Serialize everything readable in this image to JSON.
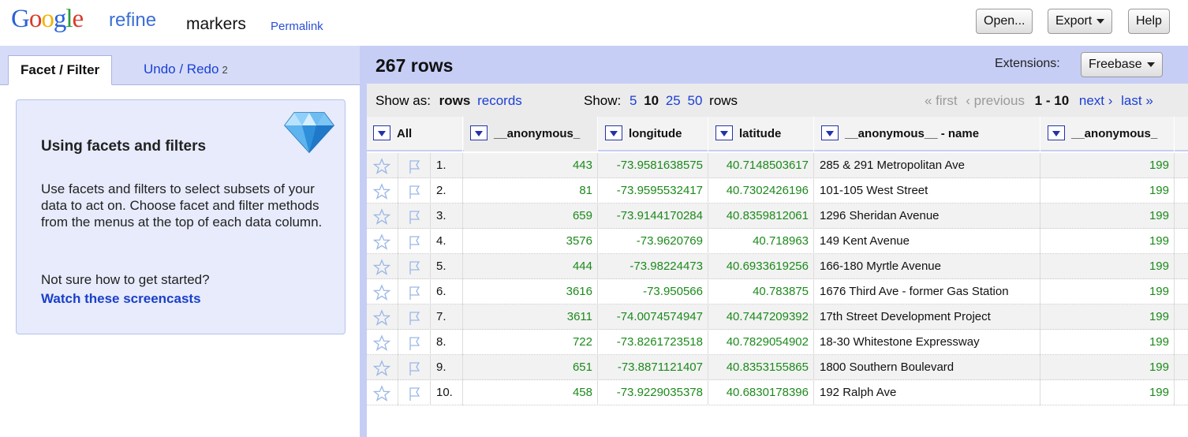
{
  "header": {
    "logo_word": "Google",
    "logo_product": "refine",
    "project_name": "markers",
    "permalink": "Permalink",
    "buttons": {
      "open": "Open...",
      "export": "Export",
      "help": "Help"
    }
  },
  "left_panel": {
    "tabs": {
      "facet": "Facet / Filter",
      "undo": "Undo / Redo",
      "undo_count": "2"
    },
    "help": {
      "title": "Using facets and filters",
      "body": "Use facets and filters to select subsets of your data to act on. Choose facet and filter methods from the menus at the top of each data column.",
      "question": "Not sure how to get started?",
      "link": "Watch these screencasts"
    }
  },
  "summary": {
    "row_count": "267 rows",
    "extensions_label": "Extensions:",
    "extensions_value": "Freebase"
  },
  "view_bar": {
    "show_as_label": "Show as:",
    "show_as_rows": "rows",
    "show_as_records": "records",
    "show_label": "Show:",
    "page_sizes": [
      "5",
      "10",
      "25",
      "50"
    ],
    "page_size_selected": "10",
    "rows_word": "rows",
    "first": "« first",
    "previous": "‹ previous",
    "range": "1 - 10",
    "next": "next ›",
    "last": "last »"
  },
  "table": {
    "all_label": "All",
    "columns": [
      "__anonymous_",
      "longitude",
      "latitude",
      "__anonymous__ - name",
      "__anonymous_"
    ],
    "rows": [
      {
        "index": "1.",
        "anon": "443",
        "longitude": "-73.9581638575",
        "latitude": "40.7148503617",
        "name": "285 & 291 Metropolitan Ave",
        "anon2": "199"
      },
      {
        "index": "2.",
        "anon": "81",
        "longitude": "-73.9595532417",
        "latitude": "40.7302426196",
        "name": "101-105 West Street",
        "anon2": "199"
      },
      {
        "index": "3.",
        "anon": "659",
        "longitude": "-73.9144170284",
        "latitude": "40.8359812061",
        "name": "1296 Sheridan Avenue",
        "anon2": "199"
      },
      {
        "index": "4.",
        "anon": "3576",
        "longitude": "-73.9620769",
        "latitude": "40.718963",
        "name": "149 Kent Avenue",
        "anon2": "199"
      },
      {
        "index": "5.",
        "anon": "444",
        "longitude": "-73.98224473",
        "latitude": "40.6933619256",
        "name": "166-180 Myrtle Avenue",
        "anon2": "199"
      },
      {
        "index": "6.",
        "anon": "3616",
        "longitude": "-73.950566",
        "latitude": "40.783875",
        "name": "1676 Third Ave - former Gas Station",
        "anon2": "199"
      },
      {
        "index": "7.",
        "anon": "3611",
        "longitude": "-74.0074574947",
        "latitude": "40.7447209392",
        "name": "17th Street Development Project",
        "anon2": "199"
      },
      {
        "index": "8.",
        "anon": "722",
        "longitude": "-73.8261723518",
        "latitude": "40.7829054902",
        "name": "18-30 Whitestone Expressway",
        "anon2": "199"
      },
      {
        "index": "9.",
        "anon": "651",
        "longitude": "-73.8871121407",
        "latitude": "40.8353155865",
        "name": "1800 Southern Boulevard",
        "anon2": "199"
      },
      {
        "index": "10.",
        "anon": "458",
        "longitude": "-73.9229035378",
        "latitude": "40.6830178396",
        "name": "192 Ralph Ave",
        "anon2": "199"
      }
    ]
  },
  "icons": {
    "star": "star-icon",
    "flag": "flag-icon",
    "dropdown": "dropdown-arrow-icon",
    "diamond": "diamond-icon"
  }
}
